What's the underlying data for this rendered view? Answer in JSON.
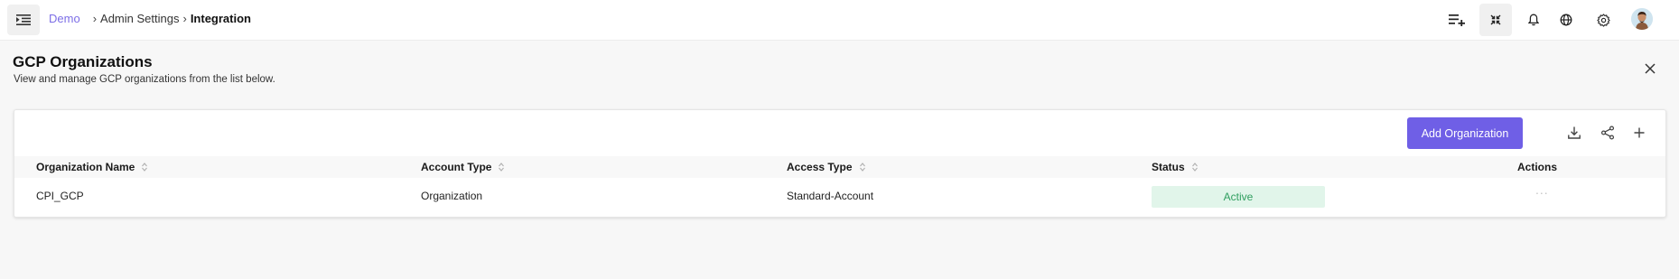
{
  "breadcrumb": {
    "root": "Demo",
    "items": [
      "Admin Settings"
    ],
    "current": "Integration",
    "separator": "›"
  },
  "top_icons": [
    "playlist-add-icon",
    "collapse-icon",
    "bell-icon",
    "globe-icon",
    "gear-icon",
    "avatar"
  ],
  "header": {
    "title": "GCP Organizations",
    "subtitle": "View and manage GCP organizations from the list below."
  },
  "toolbar": {
    "add_label": "Add Organization",
    "icons": [
      "download-icon",
      "share-icon",
      "plus-icon"
    ]
  },
  "table": {
    "columns": [
      "Organization Name",
      "Account Type",
      "Access Type",
      "Status",
      "Actions"
    ],
    "rows": [
      {
        "organization_name": "CPI_GCP",
        "account_type": "Organization",
        "access_type": "Standard-Account",
        "status": "Active",
        "actions": "..."
      }
    ]
  },
  "colors": {
    "accent": "#6f5fe6",
    "breadcrumb_link": "#7c6ee6",
    "status_active_bg": "#e1f5ea",
    "status_active_text": "#2f9e5f"
  }
}
